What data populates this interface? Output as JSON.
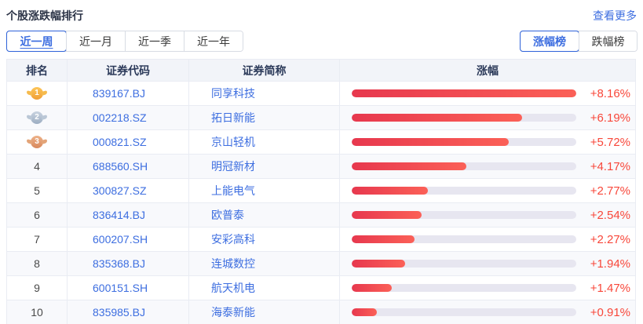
{
  "header": {
    "title": "个股涨跌幅排行",
    "more_link": "查看更多"
  },
  "period_tabs": [
    {
      "label": "近一周",
      "selected": true
    },
    {
      "label": "近一月",
      "selected": false
    },
    {
      "label": "近一季",
      "selected": false
    },
    {
      "label": "近一年",
      "selected": false
    }
  ],
  "board_tabs": [
    {
      "label": "涨幅榜",
      "selected": true
    },
    {
      "label": "跌幅榜",
      "selected": false
    }
  ],
  "table": {
    "columns": [
      "排名",
      "证券代码",
      "证券简称",
      "涨幅"
    ],
    "max_value": 8.16,
    "rows": [
      {
        "rank": 1,
        "medal": "gold",
        "code": "839167.BJ",
        "name": "同享科技",
        "change": "+8.16%",
        "value": 8.16
      },
      {
        "rank": 2,
        "medal": "silver",
        "code": "002218.SZ",
        "name": "拓日新能",
        "change": "+6.19%",
        "value": 6.19
      },
      {
        "rank": 3,
        "medal": "bronze",
        "code": "000821.SZ",
        "name": "京山轻机",
        "change": "+5.72%",
        "value": 5.72
      },
      {
        "rank": 4,
        "code": "688560.SH",
        "name": "明冠新材",
        "change": "+4.17%",
        "value": 4.17
      },
      {
        "rank": 5,
        "code": "300827.SZ",
        "name": "上能电气",
        "change": "+2.77%",
        "value": 2.77
      },
      {
        "rank": 6,
        "code": "836414.BJ",
        "name": "欧普泰",
        "change": "+2.54%",
        "value": 2.54
      },
      {
        "rank": 7,
        "code": "600207.SH",
        "name": "安彩高科",
        "change": "+2.27%",
        "value": 2.27
      },
      {
        "rank": 8,
        "code": "835368.BJ",
        "name": "连城数控",
        "change": "+1.94%",
        "value": 1.94
      },
      {
        "rank": 9,
        "code": "600151.SH",
        "name": "航天机电",
        "change": "+1.47%",
        "value": 1.47
      },
      {
        "rank": 10,
        "code": "835985.BJ",
        "name": "海泰新能",
        "change": "+0.91%",
        "value": 0.91
      }
    ]
  },
  "colors": {
    "accent_blue": "#3d6ee0",
    "percent_red": "#f8473a",
    "bar_gradient_start": "#e7384e",
    "bar_gradient_end": "#fb6057",
    "bar_track": "#e7e6f0"
  }
}
